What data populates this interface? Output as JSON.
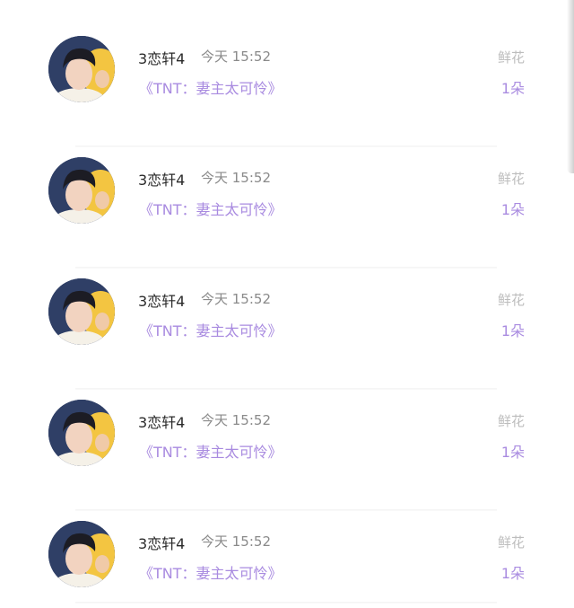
{
  "items": [
    {
      "user": "3恋轩4",
      "time": "今天 15:52",
      "book": "《TNT：妻主太可怜》",
      "gift": "鲜花",
      "count": "1朵"
    },
    {
      "user": "3恋轩4",
      "time": "今天 15:52",
      "book": "《TNT：妻主太可怜》",
      "gift": "鲜花",
      "count": "1朵"
    },
    {
      "user": "3恋轩4",
      "time": "今天 15:52",
      "book": "《TNT：妻主太可怜》",
      "gift": "鲜花",
      "count": "1朵"
    },
    {
      "user": "3恋轩4",
      "time": "今天 15:52",
      "book": "《TNT：妻主太可怜》",
      "gift": "鲜花",
      "count": "1朵"
    },
    {
      "user": "3恋轩4",
      "time": "今天 15:52",
      "book": "《TNT：妻主太可怜》",
      "gift": "鲜花",
      "count": "1朵"
    }
  ],
  "colors": {
    "accent": "#a98be0",
    "name": "#2a2a2a",
    "muted": "#8a8a8a",
    "gift_label": "#bdbdbd"
  }
}
